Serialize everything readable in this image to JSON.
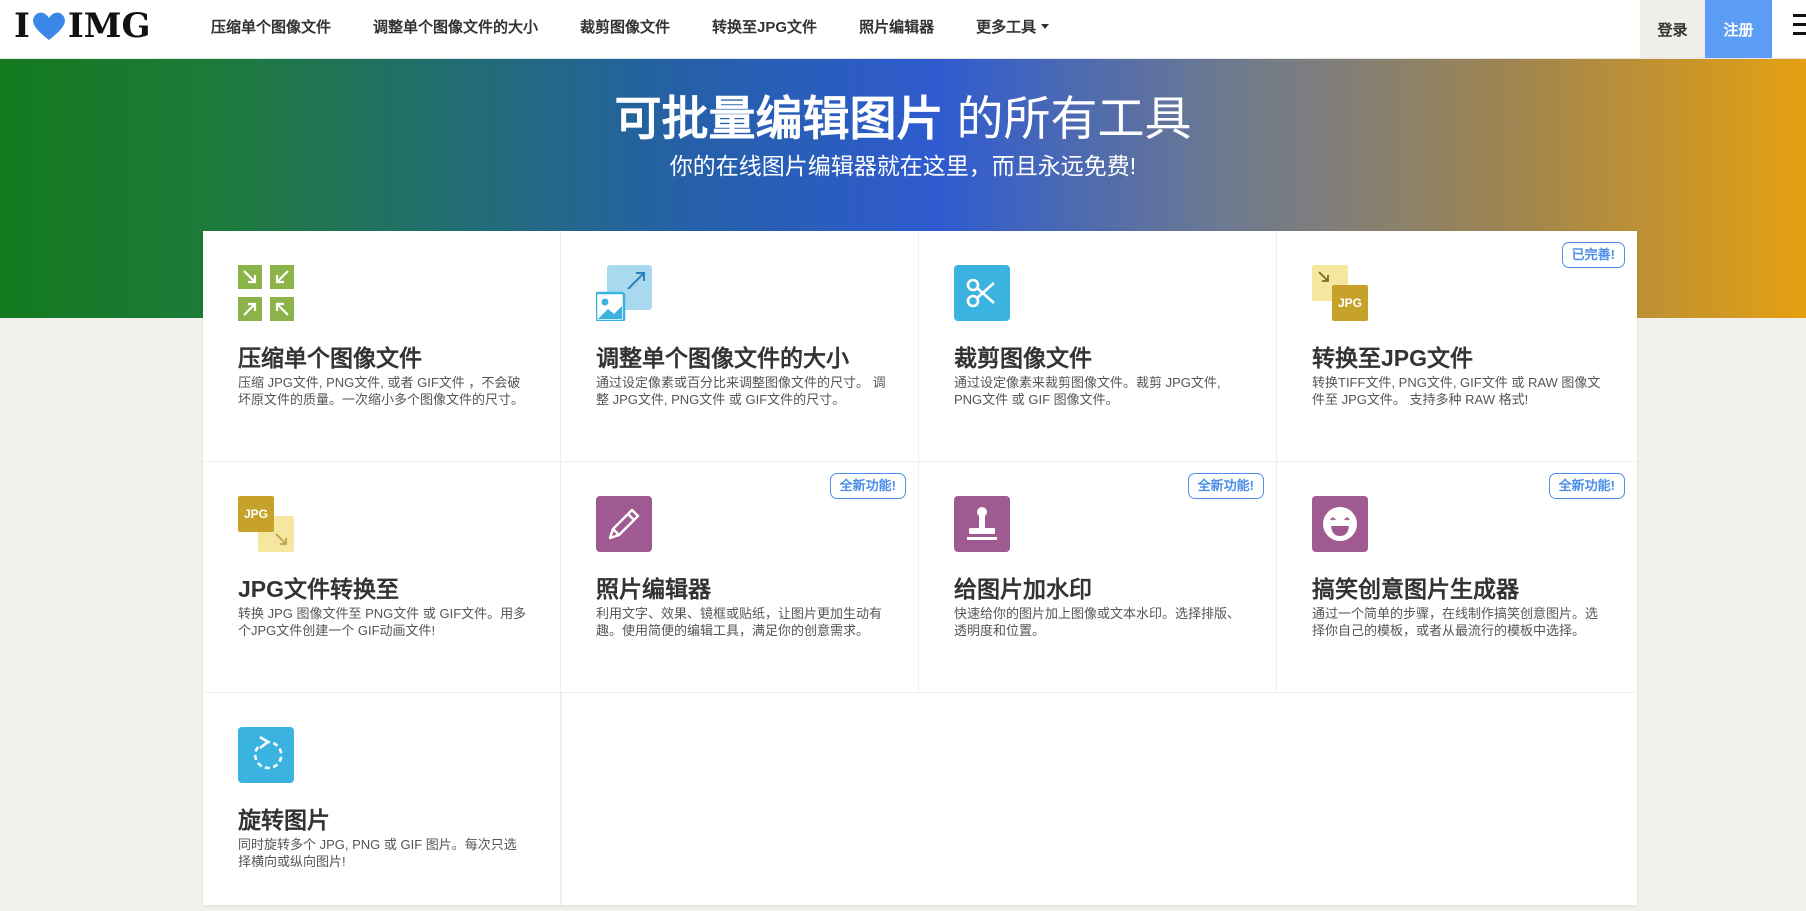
{
  "header": {
    "logo_left": "I",
    "logo_right": "IMG",
    "nav": [
      {
        "label": "压缩单个图像文件"
      },
      {
        "label": "调整单个图像文件的大小"
      },
      {
        "label": "裁剪图像文件"
      },
      {
        "label": "转换至JPG文件"
      },
      {
        "label": "照片编辑器"
      },
      {
        "label": "更多工具"
      }
    ],
    "login_label": "登录",
    "register_label": "注册"
  },
  "hero": {
    "title_strong": "可批量编辑图片",
    "title_light": " 的所有工具",
    "subtitle": "你的在线图片编辑器就在这里，而且永远免费!"
  },
  "tools": [
    {
      "icon": "compress-icon",
      "title": "压缩单个图像文件",
      "desc": "压缩 JPG文件, PNG文件, 或者 GIF文件 ，不会破坏原文件的质量。一次缩小多个图像文件的尺寸。",
      "badge": ""
    },
    {
      "icon": "resize-icon",
      "title": "调整单个图像文件的大小",
      "desc": "通过设定像素或百分比来调整图像文件的尺寸。 调整 JPG文件, PNG文件 或 GIF文件的尺寸。",
      "badge": ""
    },
    {
      "icon": "scissors-icon",
      "title": "裁剪图像文件",
      "desc": "通过设定像素来裁剪图像文件。裁剪 JPG文件, PNG文件 或 GIF 图像文件。",
      "badge": ""
    },
    {
      "icon": "convert-to-jpg-icon",
      "title": "转换至JPG文件",
      "desc": "转换TIFF文件, PNG文件, GIF文件 或 RAW 图像文件至 JPG文件。 支持多种 RAW 格式!",
      "badge": "已完善!"
    },
    {
      "icon": "convert-from-jpg-icon",
      "title": "JPG文件转换至",
      "desc": "转换 JPG 图像文件至 PNG文件 或 GIF文件。用多个JPG文件创建一个 GIF动画文件!",
      "badge": ""
    },
    {
      "icon": "pencil-icon",
      "title": "照片编辑器",
      "desc": "利用文字、效果、镜框或贴纸，让图片更加生动有趣。使用简便的编辑工具，满足你的创意需求。",
      "badge": "全新功能!"
    },
    {
      "icon": "stamp-icon",
      "title": "给图片加水印",
      "desc": "快速给你的图片加上图像或文本水印。选择排版、透明度和位置。",
      "badge": "全新功能!"
    },
    {
      "icon": "laughing-face-icon",
      "title": "搞笑创意图片生成器",
      "desc": "通过一个简单的步骤，在线制作搞笑创意图片。选择你自己的模板，或者从最流行的模板中选择。",
      "badge": "全新功能!"
    },
    {
      "icon": "rotate-icon",
      "title": "旋转图片",
      "desc": "同时旋转多个 JPG, PNG 或 GIF 图片。每次只选择横向或纵向图片!",
      "badge": ""
    }
  ],
  "colors": {
    "compress": "#8bb34a",
    "resize": "#a9d9ef",
    "crop": "#3bb3e0",
    "jpg_yellow": "#c6a22a",
    "editor_purple": "#a05a92",
    "rotate_blue": "#3bb3e0",
    "badge_blue": "#4d8fe8",
    "register_blue": "#5b9cf5"
  }
}
